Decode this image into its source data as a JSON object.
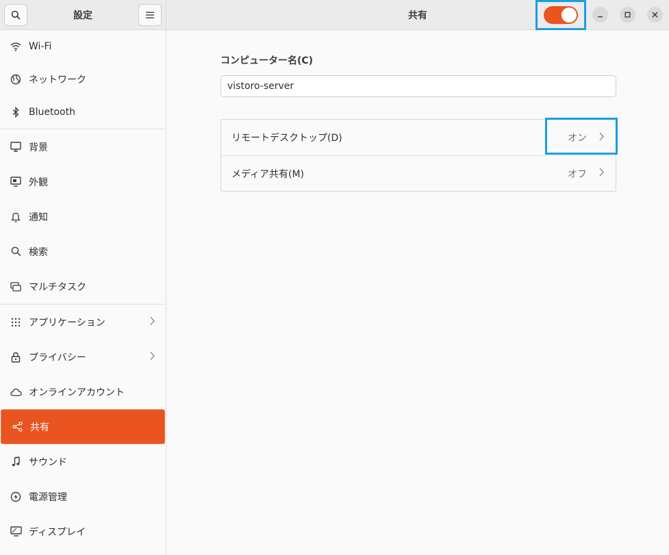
{
  "sidebar": {
    "title": "設定",
    "search_icon": "search-icon",
    "menu_icon": "hamburger-menu-icon",
    "items": [
      {
        "label": "Wi-Fi",
        "icon": "wifi-icon"
      },
      {
        "label": "ネットワーク",
        "icon": "globe-icon"
      },
      {
        "label": "Bluetooth",
        "icon": "bluetooth-icon"
      },
      {
        "label": "背景",
        "icon": "monitor-icon"
      },
      {
        "label": "外観",
        "icon": "appearance-icon"
      },
      {
        "label": "通知",
        "icon": "bell-icon"
      },
      {
        "label": "検索",
        "icon": "search-icon"
      },
      {
        "label": "マルチタスク",
        "icon": "multitask-icon"
      },
      {
        "label": "アプリケーション",
        "icon": "grid-icon"
      },
      {
        "label": "プライバシー",
        "icon": "lock-icon"
      },
      {
        "label": "オンラインアカウント",
        "icon": "cloud-icon"
      },
      {
        "label": "共有",
        "icon": "share-icon"
      },
      {
        "label": "サウンド",
        "icon": "music-note-icon"
      },
      {
        "label": "電源管理",
        "icon": "power-icon"
      },
      {
        "label": "ディスプレイ",
        "icon": "display-icon"
      }
    ]
  },
  "header": {
    "title": "共有",
    "sharing_toggle": "on"
  },
  "main": {
    "computer_name_label": "コンピューター名(C)",
    "computer_name_value": "vistoro-server",
    "rows": [
      {
        "label": "リモートデスクトップ(D)",
        "status": "オン"
      },
      {
        "label": "メディア共有(M)",
        "status": "オフ"
      }
    ]
  },
  "colors": {
    "accent": "#e95420",
    "highlight": "#1a9ee0"
  }
}
